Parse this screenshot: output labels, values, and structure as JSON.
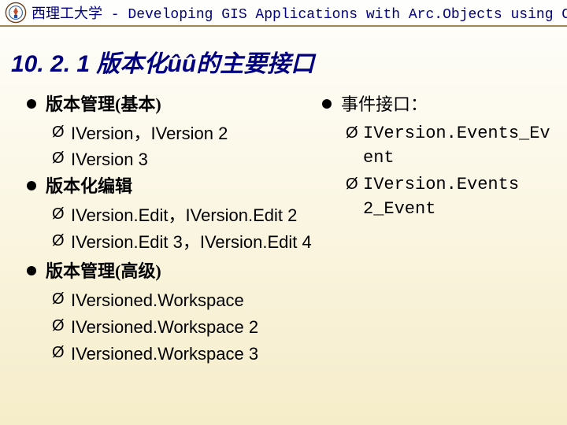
{
  "header": {
    "university": "西理工大学",
    "separator": " - ",
    "course": "Developing GIS Applications with Arc.Objects using C#. NE"
  },
  "title": "10. 2. 1  版本化ûû的主要接口",
  "left": {
    "sections": [
      {
        "heading": "版本管理(基本)",
        "items": [
          "IVersion，IVersion 2",
          "IVersion 3"
        ]
      },
      {
        "heading": "版本化编辑",
        "items": [
          "IVersion.Edit，IVersion.Edit 2",
          "IVersion.Edit 3，IVersion.Edit 4"
        ]
      },
      {
        "heading": "版本管理(高级)",
        "items": [
          "IVersioned.Workspace",
          "IVersioned.Workspace 2",
          "IVersioned.Workspace 3"
        ]
      }
    ]
  },
  "right": {
    "sections": [
      {
        "heading": "事件接口：",
        "items": [
          "IVersion.Events_Event",
          "IVersion.Events 2_Event"
        ]
      }
    ]
  }
}
